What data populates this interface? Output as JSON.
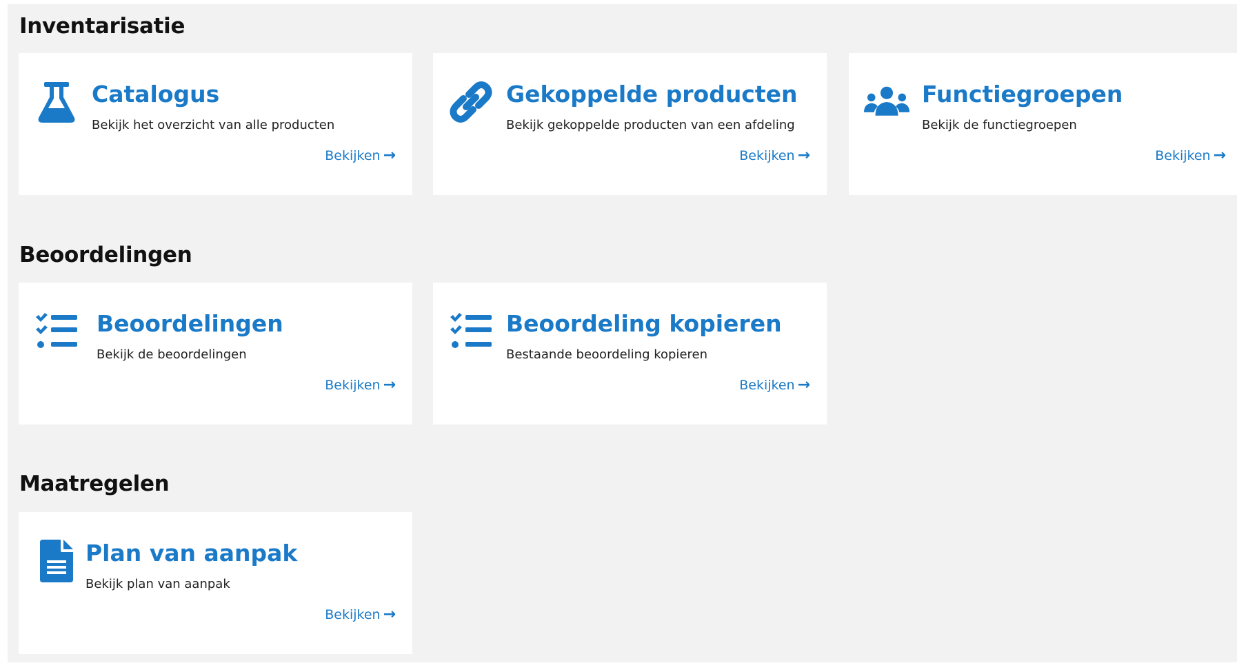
{
  "sections": [
    {
      "title": "Inventarisatie",
      "cards": [
        {
          "title": "Catalogus",
          "description": "Bekijk het overzicht van alle producten",
          "link": "Bekijken",
          "icon": "flask-icon"
        },
        {
          "title": "Gekoppelde producten",
          "description": "Bekijk gekoppelde producten van een afdeling",
          "link": "Bekijken",
          "icon": "link-icon"
        },
        {
          "title": "Functiegroepen",
          "description": "Bekijk de functiegroepen",
          "link": "Bekijken",
          "icon": "users-icon"
        }
      ]
    },
    {
      "title": "Beoordelingen",
      "cards": [
        {
          "title": "Beoordelingen",
          "description": "Bekijk de beoordelingen",
          "link": "Bekijken",
          "icon": "checklist-icon"
        },
        {
          "title": "Beoordeling kopieren",
          "description": "Bestaande beoordeling kopieren",
          "link": "Bekijken",
          "icon": "checklist-icon"
        }
      ]
    },
    {
      "title": "Maatregelen",
      "cards": [
        {
          "title": "Plan van aanpak",
          "description": "Bekijk plan van aanpak",
          "link": "Bekijken",
          "icon": "document-icon"
        }
      ]
    }
  ],
  "colors": {
    "accent": "#1a7ac8",
    "background": "#f2f2f2",
    "card": "#ffffff"
  }
}
